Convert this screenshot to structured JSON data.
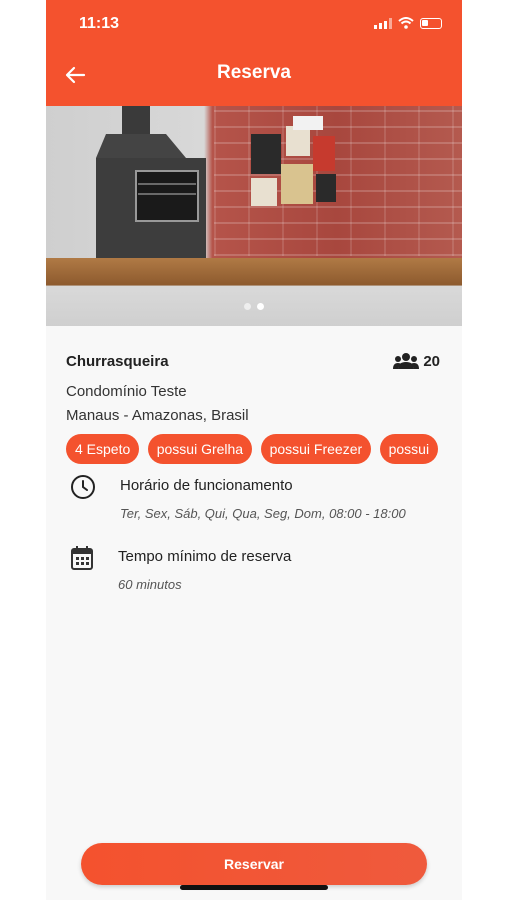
{
  "status_bar": {
    "time": "11:13"
  },
  "header": {
    "title": "Reserva"
  },
  "hero": {
    "slides": 2,
    "active_slide": 1
  },
  "venue": {
    "name": "Churrasqueira",
    "capacity": "20",
    "condominium": "Condomínio Teste",
    "location": "Manaus - Amazonas, Brasil",
    "tags": [
      "4 Espeto",
      "possui Grelha",
      "possui Freezer",
      "possui"
    ]
  },
  "hours": {
    "title": "Horário de funcionamento",
    "value": "Ter, Sex, Sáb, Qui, Qua, Seg, Dom,  08:00 - 18:00"
  },
  "min_reservation": {
    "title": "Tempo mínimo de reserva",
    "value": "60 minutos"
  },
  "cta": {
    "label": "Reservar"
  },
  "colors": {
    "accent": "#f4522e",
    "background": "#f8f8f8"
  },
  "icons": {
    "back": "arrow-left-icon",
    "capacity": "users-icon",
    "hours": "clock-icon",
    "min_reservation": "calendar-icon"
  }
}
